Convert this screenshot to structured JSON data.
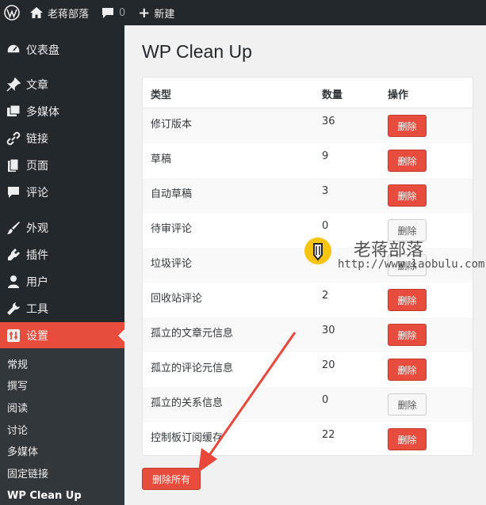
{
  "adminbar": {
    "site_name": "老蒋部落",
    "comment_count": "0",
    "new_label": "新建"
  },
  "sidebar": {
    "items": [
      {
        "label": "仪表盘"
      },
      {
        "label": "文章"
      },
      {
        "label": "多媒体"
      },
      {
        "label": "链接"
      },
      {
        "label": "页面"
      },
      {
        "label": "评论"
      },
      {
        "label": "外观"
      },
      {
        "label": "插件"
      },
      {
        "label": "用户"
      },
      {
        "label": "工具"
      },
      {
        "label": "设置"
      }
    ],
    "submenu": [
      {
        "label": "常规"
      },
      {
        "label": "撰写"
      },
      {
        "label": "阅读"
      },
      {
        "label": "讨论"
      },
      {
        "label": "多媒体"
      },
      {
        "label": "固定链接"
      },
      {
        "label": "WP Clean Up"
      }
    ],
    "accent": "#e84c3d"
  },
  "main": {
    "title": "WP Clean Up",
    "headers": {
      "type": "类型",
      "count": "数量",
      "action": "操作"
    },
    "rows": [
      {
        "type": "修订版本",
        "count": "36",
        "button": "删除",
        "active": true
      },
      {
        "type": "草稿",
        "count": "9",
        "button": "删除",
        "active": true
      },
      {
        "type": "自动草稿",
        "count": "3",
        "button": "删除",
        "active": true
      },
      {
        "type": "待审评论",
        "count": "0",
        "button": "删除",
        "active": false
      },
      {
        "type": "垃圾评论",
        "count": "",
        "button": "删除",
        "active": false
      },
      {
        "type": "回收站评论",
        "count": "2",
        "button": "删除",
        "active": true
      },
      {
        "type": "孤立的文章元信息",
        "count": "30",
        "button": "删除",
        "active": true
      },
      {
        "type": "孤立的评论元信息",
        "count": "20",
        "button": "删除",
        "active": true
      },
      {
        "type": "孤立的关系信息",
        "count": "0",
        "button": "删除",
        "active": false
      },
      {
        "type": "控制板订阅缓存",
        "count": "22",
        "button": "删除",
        "active": true
      }
    ],
    "delete_all": "删除所有"
  },
  "watermark": {
    "title": "老蒋部落",
    "url": "http://www.laobulu.com"
  }
}
